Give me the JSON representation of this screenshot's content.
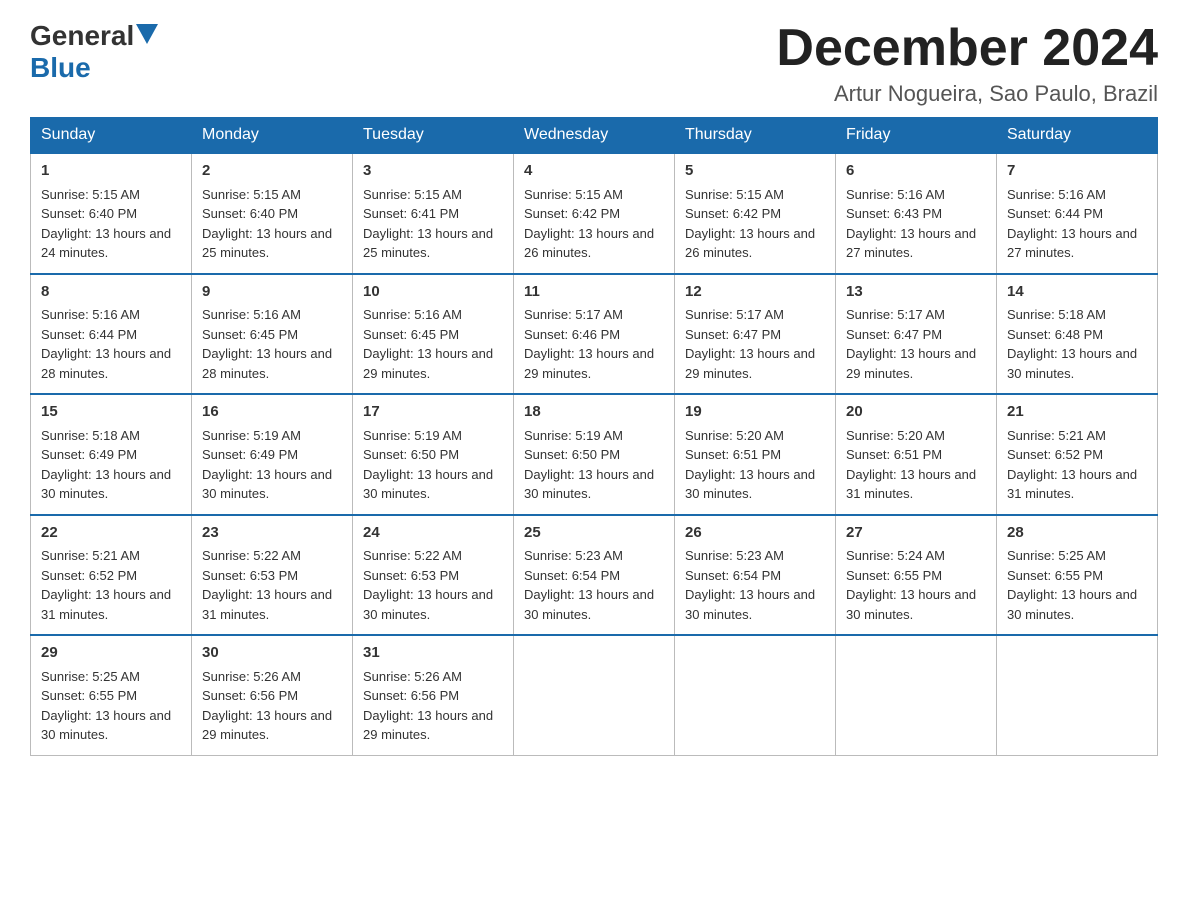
{
  "logo": {
    "general": "General",
    "triangle": "▶",
    "blue": "Blue"
  },
  "title": "December 2024",
  "subtitle": "Artur Nogueira, Sao Paulo, Brazil",
  "days": [
    "Sunday",
    "Monday",
    "Tuesday",
    "Wednesday",
    "Thursday",
    "Friday",
    "Saturday"
  ],
  "weeks": [
    [
      {
        "day": "1",
        "sunrise": "5:15 AM",
        "sunset": "6:40 PM",
        "daylight": "13 hours and 24 minutes."
      },
      {
        "day": "2",
        "sunrise": "5:15 AM",
        "sunset": "6:40 PM",
        "daylight": "13 hours and 25 minutes."
      },
      {
        "day": "3",
        "sunrise": "5:15 AM",
        "sunset": "6:41 PM",
        "daylight": "13 hours and 25 minutes."
      },
      {
        "day": "4",
        "sunrise": "5:15 AM",
        "sunset": "6:42 PM",
        "daylight": "13 hours and 26 minutes."
      },
      {
        "day": "5",
        "sunrise": "5:15 AM",
        "sunset": "6:42 PM",
        "daylight": "13 hours and 26 minutes."
      },
      {
        "day": "6",
        "sunrise": "5:16 AM",
        "sunset": "6:43 PM",
        "daylight": "13 hours and 27 minutes."
      },
      {
        "day": "7",
        "sunrise": "5:16 AM",
        "sunset": "6:44 PM",
        "daylight": "13 hours and 27 minutes."
      }
    ],
    [
      {
        "day": "8",
        "sunrise": "5:16 AM",
        "sunset": "6:44 PM",
        "daylight": "13 hours and 28 minutes."
      },
      {
        "day": "9",
        "sunrise": "5:16 AM",
        "sunset": "6:45 PM",
        "daylight": "13 hours and 28 minutes."
      },
      {
        "day": "10",
        "sunrise": "5:16 AM",
        "sunset": "6:45 PM",
        "daylight": "13 hours and 29 minutes."
      },
      {
        "day": "11",
        "sunrise": "5:17 AM",
        "sunset": "6:46 PM",
        "daylight": "13 hours and 29 minutes."
      },
      {
        "day": "12",
        "sunrise": "5:17 AM",
        "sunset": "6:47 PM",
        "daylight": "13 hours and 29 minutes."
      },
      {
        "day": "13",
        "sunrise": "5:17 AM",
        "sunset": "6:47 PM",
        "daylight": "13 hours and 29 minutes."
      },
      {
        "day": "14",
        "sunrise": "5:18 AM",
        "sunset": "6:48 PM",
        "daylight": "13 hours and 30 minutes."
      }
    ],
    [
      {
        "day": "15",
        "sunrise": "5:18 AM",
        "sunset": "6:49 PM",
        "daylight": "13 hours and 30 minutes."
      },
      {
        "day": "16",
        "sunrise": "5:19 AM",
        "sunset": "6:49 PM",
        "daylight": "13 hours and 30 minutes."
      },
      {
        "day": "17",
        "sunrise": "5:19 AM",
        "sunset": "6:50 PM",
        "daylight": "13 hours and 30 minutes."
      },
      {
        "day": "18",
        "sunrise": "5:19 AM",
        "sunset": "6:50 PM",
        "daylight": "13 hours and 30 minutes."
      },
      {
        "day": "19",
        "sunrise": "5:20 AM",
        "sunset": "6:51 PM",
        "daylight": "13 hours and 30 minutes."
      },
      {
        "day": "20",
        "sunrise": "5:20 AM",
        "sunset": "6:51 PM",
        "daylight": "13 hours and 31 minutes."
      },
      {
        "day": "21",
        "sunrise": "5:21 AM",
        "sunset": "6:52 PM",
        "daylight": "13 hours and 31 minutes."
      }
    ],
    [
      {
        "day": "22",
        "sunrise": "5:21 AM",
        "sunset": "6:52 PM",
        "daylight": "13 hours and 31 minutes."
      },
      {
        "day": "23",
        "sunrise": "5:22 AM",
        "sunset": "6:53 PM",
        "daylight": "13 hours and 31 minutes."
      },
      {
        "day": "24",
        "sunrise": "5:22 AM",
        "sunset": "6:53 PM",
        "daylight": "13 hours and 30 minutes."
      },
      {
        "day": "25",
        "sunrise": "5:23 AM",
        "sunset": "6:54 PM",
        "daylight": "13 hours and 30 minutes."
      },
      {
        "day": "26",
        "sunrise": "5:23 AM",
        "sunset": "6:54 PM",
        "daylight": "13 hours and 30 minutes."
      },
      {
        "day": "27",
        "sunrise": "5:24 AM",
        "sunset": "6:55 PM",
        "daylight": "13 hours and 30 minutes."
      },
      {
        "day": "28",
        "sunrise": "5:25 AM",
        "sunset": "6:55 PM",
        "daylight": "13 hours and 30 minutes."
      }
    ],
    [
      {
        "day": "29",
        "sunrise": "5:25 AM",
        "sunset": "6:55 PM",
        "daylight": "13 hours and 30 minutes."
      },
      {
        "day": "30",
        "sunrise": "5:26 AM",
        "sunset": "6:56 PM",
        "daylight": "13 hours and 29 minutes."
      },
      {
        "day": "31",
        "sunrise": "5:26 AM",
        "sunset": "6:56 PM",
        "daylight": "13 hours and 29 minutes."
      },
      null,
      null,
      null,
      null
    ]
  ],
  "labels": {
    "sunrise": "Sunrise: ",
    "sunset": "Sunset: ",
    "daylight": "Daylight: "
  }
}
